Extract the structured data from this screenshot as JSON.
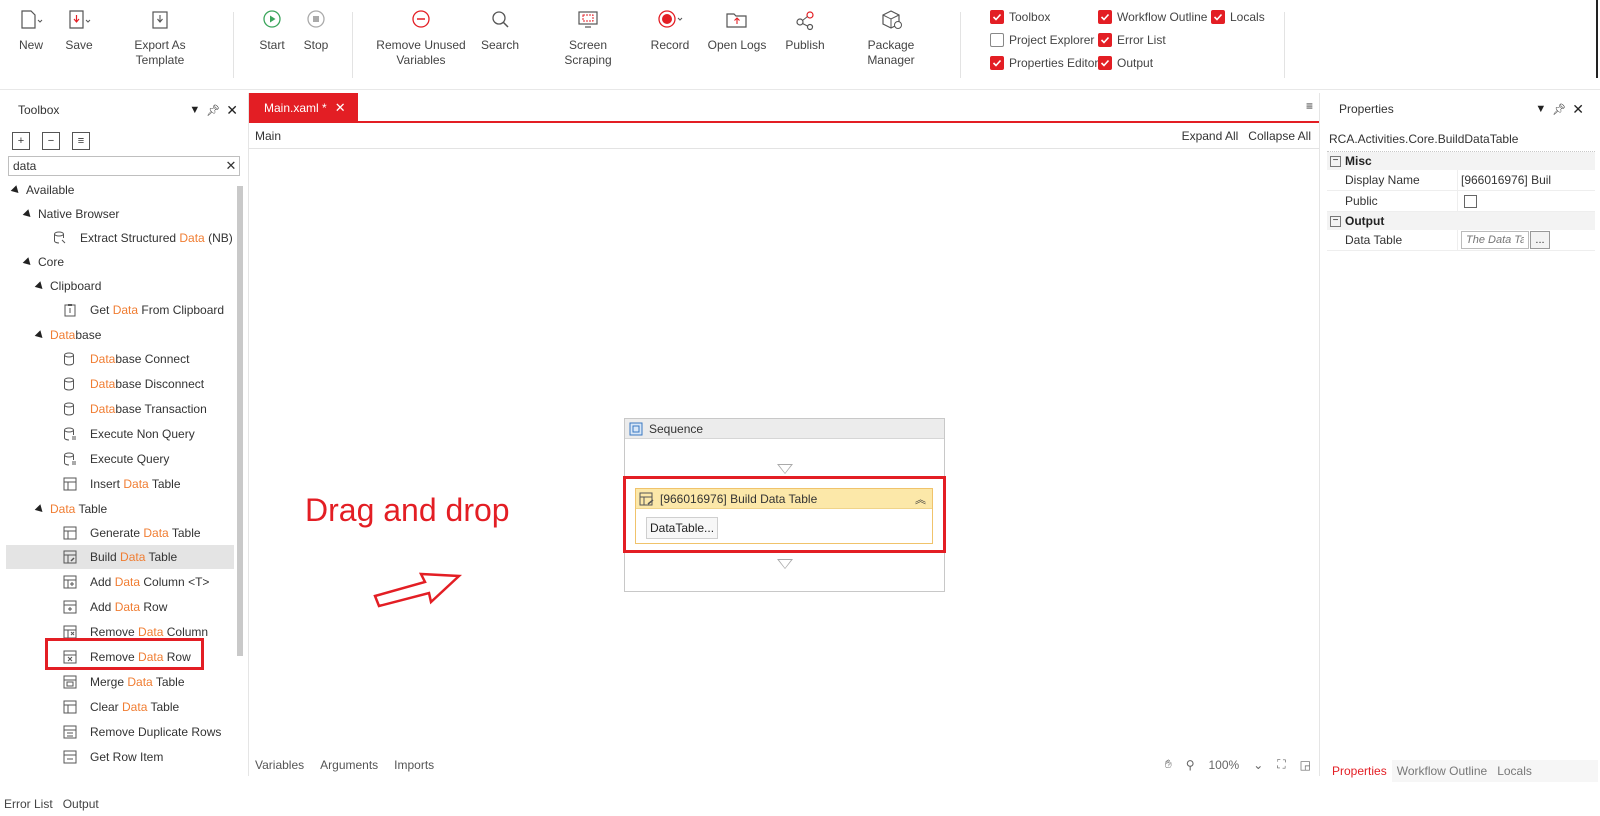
{
  "ribbon": {
    "new": "New",
    "save": "Save",
    "export_template": "Export As Template",
    "start": "Start",
    "stop": "Stop",
    "remove_unused_1": "Remove Unused",
    "remove_unused_2": "Variables",
    "search": "Search",
    "screen_scraping": "Screen Scraping",
    "record": "Record",
    "open_logs": "Open Logs",
    "publish": "Publish",
    "package_manager": "Package Manager",
    "checks": [
      {
        "label": "Toolbox",
        "checked": true
      },
      {
        "label": "Workflow Outline",
        "checked": true
      },
      {
        "label": "Locals",
        "checked": true
      },
      {
        "label": "Project Explorer",
        "checked": false
      },
      {
        "label": "Error List",
        "checked": true
      },
      {
        "label": "Properties Editor",
        "checked": true
      },
      {
        "label": "Output",
        "checked": true
      }
    ]
  },
  "toolbox": {
    "title": "Toolbox",
    "search_value": "data",
    "tree": {
      "available": "Available",
      "native_browser": "Native Browser",
      "extract_pre": "Extract Structured ",
      "extract_hl": "Data",
      "extract_post": " (NB)",
      "core": "Core",
      "clipboard": "Clipboard",
      "get_data_pre": "Get ",
      "get_data_hl": "Data",
      "get_data_post": " From Clipboard",
      "database_hl": "Data",
      "database_post": "base",
      "db_connect_hl": "Data",
      "db_connect_post": "base Connect",
      "db_disconnect_hl": "Data",
      "db_disconnect_post": "base Disconnect",
      "db_transaction_hl": "Data",
      "db_transaction_post": "base Transaction",
      "exec_non_query": "Execute Non Query",
      "exec_query": "Execute Query",
      "insert_pre": "Insert ",
      "insert_hl": "Data",
      "insert_post": " Table",
      "datatable_hl": "Data",
      "datatable_post": " Table",
      "generate_pre": "Generate ",
      "generate_hl": "Data",
      "generate_post": " Table",
      "build_pre": "Build ",
      "build_hl": "Data",
      "build_post": " Table",
      "addcol_pre": "Add ",
      "addcol_hl": "Data",
      "addcol_post": " Column <T>",
      "addrow_pre": "Add ",
      "addrow_hl": "Data",
      "addrow_post": " Row",
      "remcol_pre": "Remove ",
      "remcol_hl": "Data",
      "remcol_post": " Column",
      "remrow_pre": "Remove ",
      "remrow_hl": "Data",
      "remrow_post": " Row",
      "merge_pre": "Merge ",
      "merge_hl": "Data",
      "merge_post": " Table",
      "clear_pre": "Clear ",
      "clear_hl": "Data",
      "clear_post": " Table",
      "remove_dup": "Remove Duplicate Rows",
      "get_row": "Get Row Item"
    }
  },
  "designer": {
    "tab_label": "Main.xaml *",
    "breadcrumb": "Main",
    "expand_all": "Expand All",
    "collapse_all": "Collapse All",
    "annotation": "Drag and drop",
    "sequence_title": "Sequence",
    "activity_title": "[966016976] Build Data Table",
    "activity_button": "DataTable...",
    "bottom_tabs": [
      "Variables",
      "Arguments",
      "Imports"
    ],
    "zoom": "100%"
  },
  "properties": {
    "title": "Properties",
    "type_name": "RCA.Activities.Core.BuildDataTable",
    "cat_misc": "Misc",
    "display_name_label": "Display Name",
    "display_name_value": "[966016976] Buil",
    "public_label": "Public",
    "cat_output": "Output",
    "data_table_label": "Data Table",
    "data_table_placeholder": "The Data Ta",
    "tabs": [
      "Properties",
      "Workflow Outline",
      "Locals"
    ]
  },
  "bottom_tabs": [
    "Error List",
    "Output"
  ],
  "colors": {
    "accent": "#e31e24",
    "highlight": "#f07d32",
    "activity_header": "#fce8a9"
  }
}
